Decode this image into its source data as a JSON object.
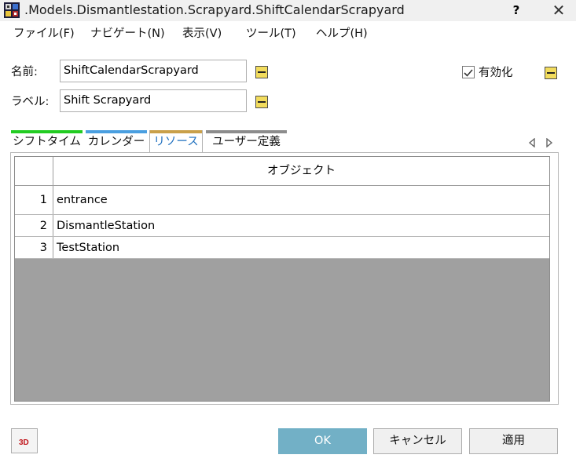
{
  "window": {
    "title": ".Models.Dismantlestation.Scrapyard.ShiftCalendarScrapyard",
    "help_label": "?",
    "close_label": "✕"
  },
  "menu": [
    "ファイル(F)",
    "ナビゲート(N)",
    "表示(V)",
    "ツール(T)",
    "ヘルプ(H)"
  ],
  "form": {
    "name_label": "名前:",
    "name_value": "ShiftCalendarScrapyard",
    "label_label": "ラベル:",
    "label_value": "Shift Scrapyard",
    "enabled_label": "有効化",
    "enabled_checked": true
  },
  "tabs": [
    {
      "label": "シフトタイム",
      "color": "#22cc22",
      "active": false
    },
    {
      "label": "カレンダー",
      "color": "#4a9fe0",
      "active": false
    },
    {
      "label": "リソース",
      "color": "#c9a04a",
      "active": true
    },
    {
      "label": "ユーザー定義",
      "color": "#8c8c8c",
      "active": false
    }
  ],
  "grid": {
    "column_header": "オブジェクト",
    "rows": [
      {
        "num": "1",
        "value": "entrance"
      },
      {
        "num": "2",
        "value": "DismantleStation"
      },
      {
        "num": "3",
        "value": "TestStation"
      }
    ]
  },
  "buttons": {
    "three_d": "3D",
    "ok": "OK",
    "cancel": "キャンセル",
    "apply": "適用"
  },
  "colors": {
    "accent_ok": "#72b0c6",
    "minus_button": "#f2dc5d",
    "grid_empty": "#a0a0a0"
  }
}
